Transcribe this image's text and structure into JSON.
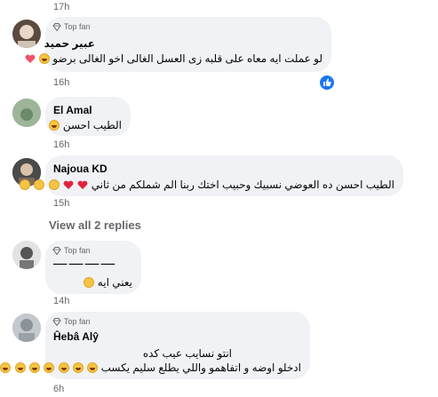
{
  "comments": [
    {
      "badge": "Top fan",
      "name": "عبير حميد",
      "text": "لو عملت ايه معاه على قلبه زى العسل الغالى اخو الغالى برضو",
      "emoji": "😜💝",
      "time": "16h",
      "reaction_icon": "like-icon"
    },
    {
      "name": "El Amal",
      "text": "الطيب احسن",
      "emoji": "😂",
      "time": "16h"
    },
    {
      "name": "Najoua KD",
      "text": "الطيب احسن ده العوضي نسبيك وحبيب اختك ربنا الم شملكم من ثاني",
      "emoji": "❤️❤️🤲🤲🤲",
      "time": "15h"
    },
    {
      "badge": "Top fan",
      "name": "ـــــ ـــــ ـــــ ـــــ",
      "text": "يعني ايه",
      "emoji": "😳",
      "time": "14h"
    },
    {
      "badge": "Top fan",
      "name": "Ĥebâ Alŷ",
      "line1": "انتو نسايب عيب كده",
      "line2": "ادخلو اوضه و اتفاهمو واللي يطلع سليم يكسب",
      "emoji": "🤣🤣🤣🤣🤣🤣🤣",
      "time": "6h"
    }
  ],
  "top_time": "17h",
  "view_replies": "View all 2 replies",
  "colors": {
    "bubble": "#f0f2f5",
    "meta": "#65676b",
    "like_blue": "#1877f2"
  }
}
